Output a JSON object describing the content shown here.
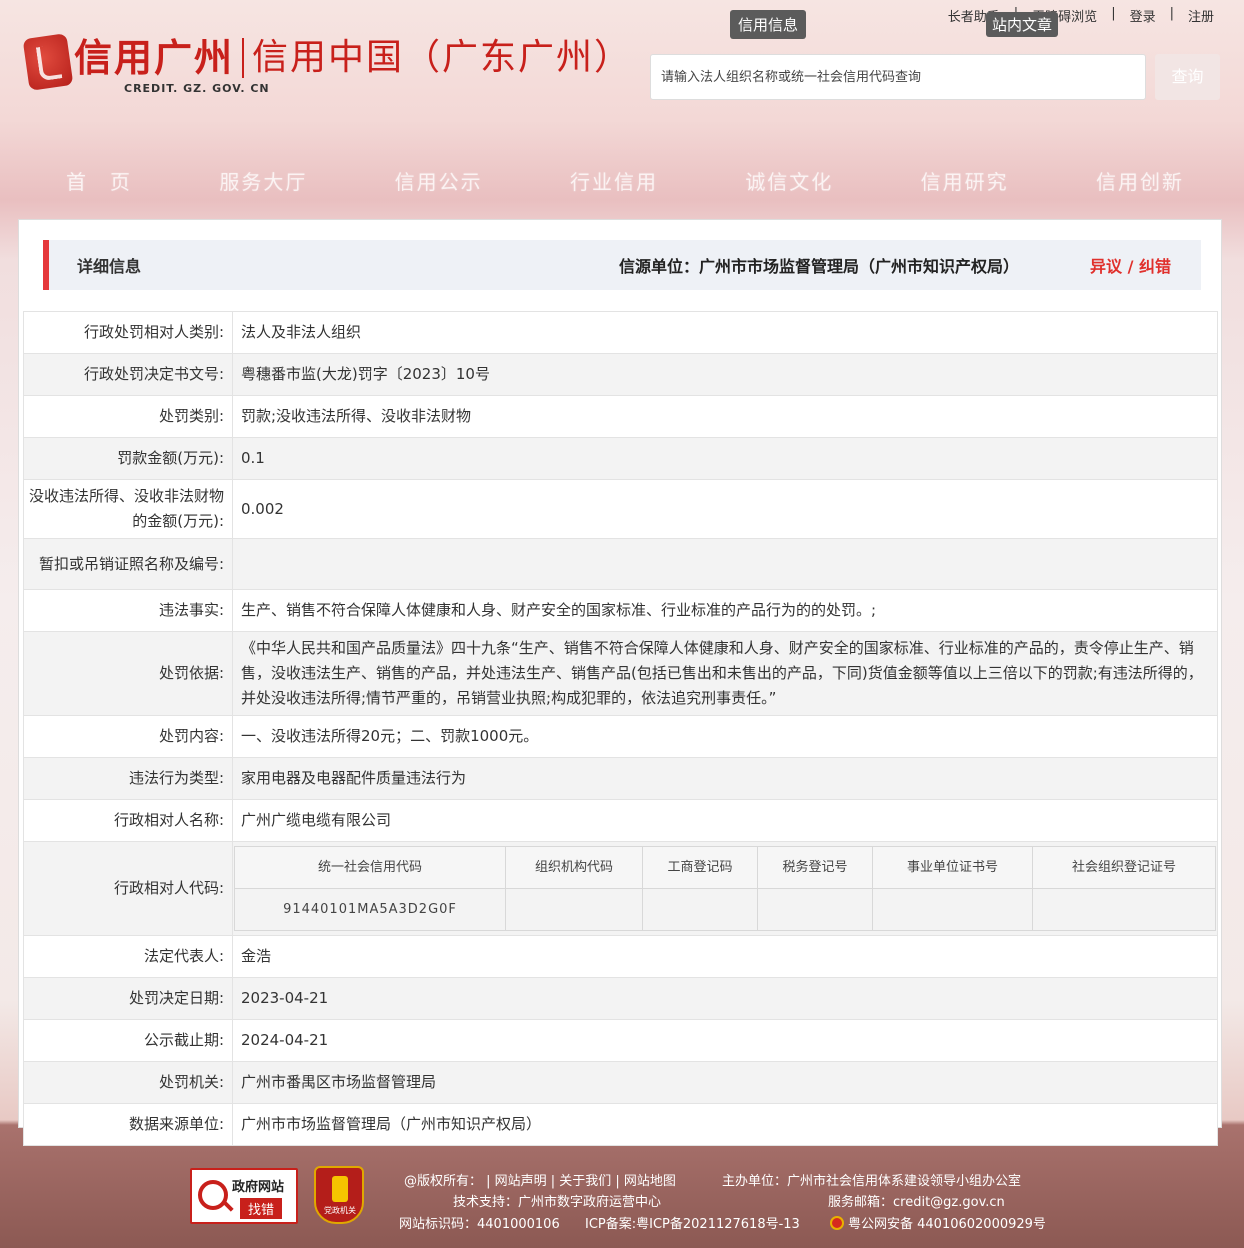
{
  "header": {
    "logo_title": "信用广州",
    "logo_subtitle": "信用中国（广东广州）",
    "logo_url": "CREDIT. GZ. GOV. CN",
    "top_links": [
      "长者助手",
      "无障碍浏览",
      "登录",
      "注册"
    ],
    "search_tabs": [
      "信用信息",
      "站内文章"
    ],
    "search_placeholder": "请输入法人组织名称或统一社会信用代码查询",
    "search_button": "查询"
  },
  "nav": [
    "首　页",
    "服务大厅",
    "信用公示",
    "行业信用",
    "诚信文化",
    "信用研究",
    "信用创新"
  ],
  "detail": {
    "title": "详细信息",
    "source": "信源单位：广州市市场监督管理局（广州市知识产权局）",
    "objection": "异议 / 纠错"
  },
  "rows": [
    {
      "label": "行政处罚相对人类别:",
      "value": "法人及非法人组织"
    },
    {
      "label": "行政处罚决定书文号:",
      "value": "粤穗番市监(大龙)罚字〔2023〕10号"
    },
    {
      "label": "处罚类别:",
      "value": "罚款;没收违法所得、没收非法财物"
    },
    {
      "label": "罚款金额(万元):",
      "value": "0.1"
    },
    {
      "label": "没收违法所得、没收非法财物的金额(万元):",
      "value": "0.002"
    },
    {
      "label": "暂扣或吊销证照名称及编号:",
      "value": ""
    },
    {
      "label": "违法事实:",
      "value": "生产、销售不符合保障人体健康和人身、财产安全的国家标准、行业标准的产品行为的的处罚。;"
    },
    {
      "label": "处罚依据:",
      "value": "《中华人民共和国产品质量法》四十九条“生产、销售不符合保障人体健康和人身、财产安全的国家标准、行业标准的产品的，责令停止生产、销售，没收违法生产、销售的产品，并处违法生产、销售产品(包括已售出和未售出的产品，下同)货值金额等值以上三倍以下的罚款;有违法所得的，并处没收违法所得;情节严重的，吊销营业执照;构成犯罪的，依法追究刑事责任。”"
    },
    {
      "label": "处罚内容:",
      "value": "一、没收违法所得20元；二、罚款1000元。"
    },
    {
      "label": "违法行为类型:",
      "value": "家用电器及电器配件质量违法行为"
    },
    {
      "label": "行政相对人名称:",
      "value": "广州广缆电缆有限公司"
    }
  ],
  "codes": {
    "label": "行政相对人代码:",
    "headers": [
      "统一社会信用代码",
      "组织机构代码",
      "工商登记码",
      "税务登记号",
      "事业单位证书号",
      "社会组织登记证号"
    ],
    "values": [
      "91440101MA5A3D2G0F",
      "",
      "",
      "",
      "",
      ""
    ]
  },
  "rows2": [
    {
      "label": "法定代表人:",
      "value": "金浩"
    },
    {
      "label": "处罚决定日期:",
      "value": "2023-04-21"
    },
    {
      "label": "公示截止期:",
      "value": "2024-04-21"
    },
    {
      "label": "处罚机关:",
      "value": "广州市番禺区市场监督管理局"
    },
    {
      "label": "数据来源单位:",
      "value": "广州市市场监督管理局（广州市知识产权局）"
    }
  ],
  "footer": {
    "gov_badge_top": "政府网站",
    "gov_badge_bottom": "找错",
    "party_badge": "党政机关",
    "links": "@版权所有： | 网站声明 | 关于我们 | 网站地图",
    "host": "主办单位：广州市社会信用体系建设领导小组办公室",
    "tech": "技术支持：广州市数字政府运营中心",
    "email": "服务邮箱：credit@gz.gov.cn",
    "site_id": "网站标识码：4401000106",
    "icp": "ICP备案:粤ICP备2021127618号-13",
    "police": "粤公网安备 44010602000929号"
  }
}
